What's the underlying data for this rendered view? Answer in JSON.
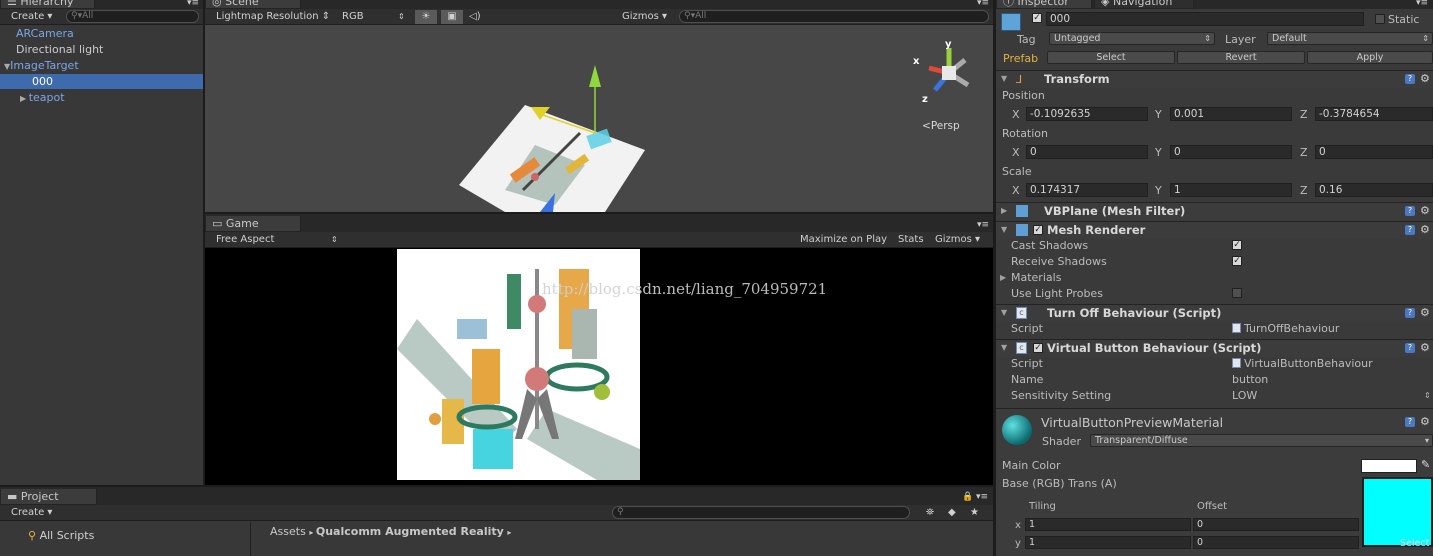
{
  "hierarchy": {
    "tab": "Hierarchy",
    "create": "Create",
    "search_placeholder": "All",
    "items": [
      {
        "label": "ARCamera"
      },
      {
        "label": "Directional light"
      },
      {
        "label": "ImageTarget"
      },
      {
        "label": "000"
      },
      {
        "label": "teapot"
      }
    ]
  },
  "scene": {
    "tab": "Scene",
    "render_mode": "Lightmap Resolution",
    "color_mode": "RGB",
    "gizmos": "Gizmos",
    "search_placeholder": "All",
    "persp": "Persp",
    "axis_x": "x",
    "axis_y": "y",
    "axis_z": "z"
  },
  "game": {
    "tab": "Game",
    "aspect": "Free Aspect",
    "maximize": "Maximize on Play",
    "stats": "Stats",
    "gizmos": "Gizmos",
    "watermark": "http://blog.csdn.net/liang_704959721"
  },
  "project": {
    "tab": "Project",
    "create": "Create",
    "favorite": "All Scripts",
    "breadcrumb": [
      "Assets",
      "Qualcomm Augmented Reality"
    ]
  },
  "inspector": {
    "tab": "Inspector",
    "tab2": "Navigation",
    "object_name": "000",
    "static_label": "Static",
    "tag_label": "Tag",
    "tag_value": "Untagged",
    "layer_label": "Layer",
    "layer_value": "Default",
    "prefab_label": "Prefab",
    "prefab_select": "Select",
    "prefab_revert": "Revert",
    "prefab_apply": "Apply",
    "transform": {
      "title": "Transform",
      "position_label": "Position",
      "position": {
        "x": "-0.1092635",
        "y": "0.001",
        "z": "-0.3784654"
      },
      "rotation_label": "Rotation",
      "rotation": {
        "x": "0",
        "y": "0",
        "z": "0"
      },
      "scale_label": "Scale",
      "scale": {
        "x": "0.174317",
        "y": "1",
        "z": "0.16"
      },
      "lx": "X",
      "ly": "Y",
      "lz": "Z"
    },
    "mesh_filter": {
      "title": "VBPlane (Mesh Filter)"
    },
    "mesh_renderer": {
      "title": "Mesh Renderer",
      "cast_shadows": "Cast Shadows",
      "receive_shadows": "Receive Shadows",
      "materials": "Materials",
      "use_light_probes": "Use Light Probes"
    },
    "turn_off": {
      "title": "Turn Off Behaviour (Script)",
      "script_label": "Script",
      "script_value": "TurnOffBehaviour"
    },
    "virtual_button": {
      "title": "Virtual Button Behaviour (Script)",
      "script_label": "Script",
      "script_value": "VirtualButtonBehaviour",
      "name_label": "Name",
      "name_value": "button",
      "sensitivity_label": "Sensitivity Setting",
      "sensitivity_value": "LOW"
    },
    "material": {
      "name": "VirtualButtonPreviewMaterial",
      "shader_label": "Shader",
      "shader_value": "Transparent/Diffuse",
      "main_color_label": "Main Color",
      "base_label": "Base (RGB) Trans (A)",
      "tiling_label": "Tiling",
      "offset_label": "Offset",
      "tiling": {
        "x": "1",
        "y": "1"
      },
      "offset": {
        "x": "0",
        "y": "0"
      },
      "select_label": "Select",
      "main_color": "#ffffff",
      "texture_color": "#00ffff"
    }
  }
}
